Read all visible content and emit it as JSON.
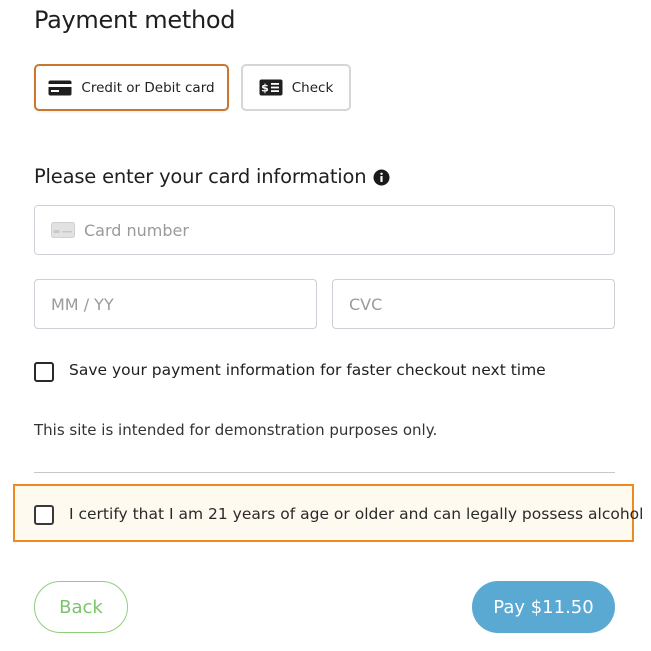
{
  "header": {
    "title": "Payment method"
  },
  "payment_methods": [
    {
      "label": "Credit or Debit card",
      "icon": "credit-card-icon",
      "selected": true
    },
    {
      "label": "Check",
      "icon": "check-dollar-icon",
      "selected": false
    }
  ],
  "card_section": {
    "heading": "Please enter your card information",
    "info_icon": "info-icon",
    "card_number": {
      "value": "",
      "placeholder": "Card number"
    },
    "expiry": {
      "value": "",
      "placeholder": "MM / YY"
    },
    "cvc": {
      "value": "",
      "placeholder": "CVC"
    }
  },
  "save_payment": {
    "label": "Save your payment information for faster checkout next time",
    "checked": false
  },
  "demo_note": "This site is intended for demonstration purposes only.",
  "certify": {
    "label": "I certify that I am 21 years of age or older and can legally possess alcohol",
    "checked": false
  },
  "actions": {
    "back_label": "Back",
    "pay_label": "Pay $11.50"
  },
  "colors": {
    "selected_border": "#c9772e",
    "certify_border": "#ef8a1e",
    "pay_button": "#5aa9d3",
    "back_button_text": "#7cc46b"
  }
}
